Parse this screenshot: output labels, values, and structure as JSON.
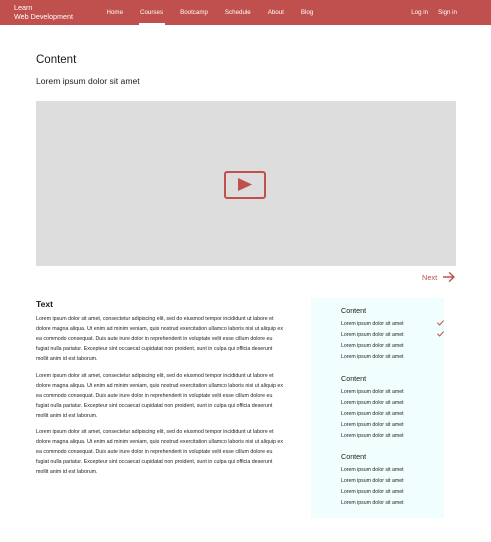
{
  "brand": {
    "line1": "Learn",
    "line2": "Web Development"
  },
  "nav": {
    "items": [
      {
        "label": "Home",
        "active": false
      },
      {
        "label": "Courses",
        "active": true
      },
      {
        "label": "Bootcamp",
        "active": false
      },
      {
        "label": "Schedule",
        "active": false
      },
      {
        "label": "About",
        "active": false
      },
      {
        "label": "Blog",
        "active": false
      }
    ],
    "login": "Log in",
    "signin": "Sign in"
  },
  "main": {
    "title": "Content",
    "subtitle": "Lorem ipsum dolor sit amet",
    "video": {
      "icon": "play-icon"
    },
    "next_label": "Next",
    "text_heading": "Text",
    "paragraphs": [
      "Lorem ipsum dolor sit amet, consectetur adipiscing elit, sed do eiusmod tempor incididunt ut labore et dolore magna aliqua. Ut enim ad minim veniam, quis nostrud exercitation ullamco laboris nisi ut aliquip ex ea commodo consequat. Duis aute irure dolor in reprehenderit in voluptate velit esse cillum dolore eu fugiat nulla pariatur. Excepteur sint occaecat cupidatat non proident, sunt in culpa qui officia deserunt mollit anim id est laborum.",
      "Lorem ipsum dolor sit amet, consectetur adipiscing elit, sed do eiusmod tempor incididunt ut labore et dolore magna aliqua. Ut enim ad minim veniam, quis nostrud exercitation ullamco laboris nisi ut aliquip ex ea commodo consequat. Duis aute irure dolor in reprehenderit in voluptate velit esse cillum dolore eu fugiat nulla pariatur. Excepteur sint occaecat cupidatat non proident, sunt in culpa qui officia deserunt mollit anim id est laborum.",
      "Lorem ipsum dolor sit amet, consectetur adipiscing elit, sed do eiusmod tempor incididunt ut labore et dolore magna aliqua. Ut enim ad minim veniam, quis nostrud exercitation ullamco laboris nisi ut aliquip ex ea commodo consequat. Duis aute irure dolor in reprehenderit in voluptate velit esse cillum dolore eu fugiat nulla pariatur. Excepteur sint occaecat cupidatat non proident, sunt in culpa qui officia deserunt mollit anim id est laborum."
    ]
  },
  "sidebar": {
    "sections": [
      {
        "heading": "Content",
        "items": [
          {
            "label": "Lorem ipsum dolor sit amet",
            "done": true
          },
          {
            "label": "Lorem ipsum dolor sit amet",
            "done": true
          },
          {
            "label": "Lorem ipsum dolor sit amet",
            "done": false
          },
          {
            "label": "Lorem ipsum dolor sit amet",
            "done": false
          }
        ]
      },
      {
        "heading": "Content",
        "items": [
          {
            "label": "Lorem ipsum dolor sit amet",
            "done": false
          },
          {
            "label": "Lorem ipsum dolor sit amet",
            "done": false
          },
          {
            "label": "Lorem ipsum dolor sit amet",
            "done": false
          },
          {
            "label": "Lorem ipsum dolor sit amet",
            "done": false
          },
          {
            "label": "Lorem ipsum dolor sit amet",
            "done": false
          }
        ]
      },
      {
        "heading": "Content",
        "items": [
          {
            "label": "Lorem ipsum dolor sit amet",
            "done": false
          },
          {
            "label": "Lorem ipsum dolor sit amet",
            "done": false
          },
          {
            "label": "Lorem ipsum dolor sit amet",
            "done": false
          },
          {
            "label": "Lorem ipsum dolor sit amet",
            "done": false
          }
        ]
      }
    ]
  },
  "colors": {
    "accent": "#c0504d",
    "video_bg": "#dddddd",
    "sidebar_bg": "#f0fffd"
  }
}
